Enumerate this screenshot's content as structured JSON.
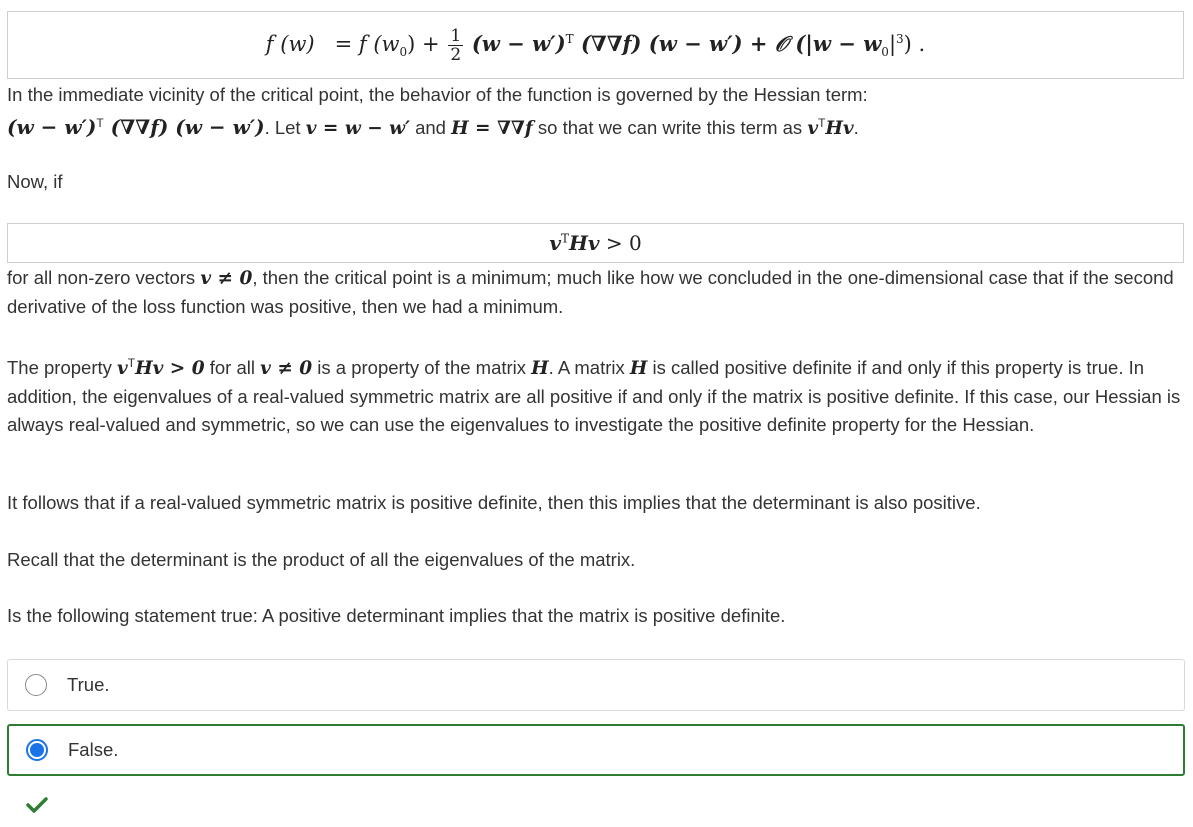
{
  "equation1": {
    "lhs": "f (w)",
    "eq": "= f (w",
    "sub0": "0",
    "plus": ") +",
    "frac_num": "1",
    "frac_den": "2",
    "quad": "(w − w′)",
    "T": "T",
    "hess": " (∇∇f) (w − w′) + 𝒪 (|w − w",
    "sub0b": "0",
    "tail": "|",
    "cube": "3",
    "end": ") ."
  },
  "p1": {
    "line1": "In the immediate vicinity of the critical point, the behavior of the function is governed by the Hessian term:",
    "m_term": "(w − w′)",
    "m_T": "T",
    "m_term2": " (∇∇f) (w − w′)",
    "t1": ". Let ",
    "m_v": "v = w − w′",
    "t2": " and ",
    "m_H": "H = ∇∇f",
    "t3": " so that we can write this term as ",
    "m_v2": "v",
    "m_T2": "T",
    "m_Hv": "Hv",
    "t4": "."
  },
  "p_now": "Now, if",
  "equation2": {
    "v": "v",
    "T": "T",
    "Hv": "Hv",
    "rest": " > 0"
  },
  "p2": {
    "t1": "for all non-zero vectors ",
    "m_v": "v ≠ 0",
    "t2": ", then the critical point is a minimum; much like how we concluded in the one-dimensional case that if the second derivative of the loss function was positive, then we had a minimum."
  },
  "p3": {
    "t1": "The property ",
    "m_v": "v",
    "m_T": "T",
    "m_Hv": "Hv > 0",
    "t2": " for all ",
    "m_v2": "v ≠ 0",
    "t3": " is a property of the matrix ",
    "m_H": "H",
    "t4": ". A matrix ",
    "m_H2": "H",
    "t5": " is called positive definite if and only if this property is true. In addition, the eigenvalues of a real-valued symmetric matrix are all positive if and only if the matrix is positive definite. If this case, our Hessian is always real-valued and symmetric, so we can use the eigenvalues to investigate the positive definite property for the Hessian."
  },
  "p4": "It follows that if a real-valued symmetric matrix is positive definite, then this implies that the determinant is also positive.",
  "p5": "Recall that the determinant is the product of all the eigenvalues of the matrix.",
  "p6": "Is the following statement true: A positive determinant implies that the matrix is positive definite.",
  "options": [
    {
      "label": "True.",
      "selected": false
    },
    {
      "label": "False.",
      "selected": true
    }
  ],
  "colors": {
    "correct": "#2e7d32",
    "radio_selected": "#1a73e8"
  },
  "result_icon": "checkmark-icon"
}
